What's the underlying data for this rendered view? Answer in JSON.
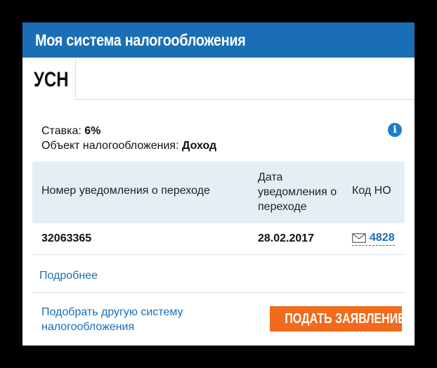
{
  "widget": {
    "title": "Моя система налогообложения",
    "active_tab": "УСН"
  },
  "info": {
    "rate_label": "Ставка:",
    "rate_value": "6%",
    "object_label": "Объект налогообложения:",
    "object_value": "Доход",
    "info_glyph": "i"
  },
  "table": {
    "headers": {
      "notice_number": "Номер уведомления о переходе",
      "notice_date": "Дата уведомления о переходе",
      "tax_office_code": "Код НО"
    },
    "rows": [
      {
        "notice_number": "32063365",
        "notice_date": "28.02.2017",
        "tax_office_code": "4828"
      }
    ]
  },
  "links": {
    "more": "Подробнее",
    "choose_other": "Подобрать другую систему налогообложения"
  },
  "buttons": {
    "apply": "ПОДАТЬ ЗАЯВЛЕНИЕ"
  },
  "icons": {
    "info": "info-icon",
    "mail": "mail-icon"
  },
  "colors": {
    "header_bg": "#1a6eb5",
    "link": "#1a6eb5",
    "table_header_bg": "#e6eef5",
    "button_bg": "#f26a1b",
    "info_icon": "#1a7fd0"
  }
}
